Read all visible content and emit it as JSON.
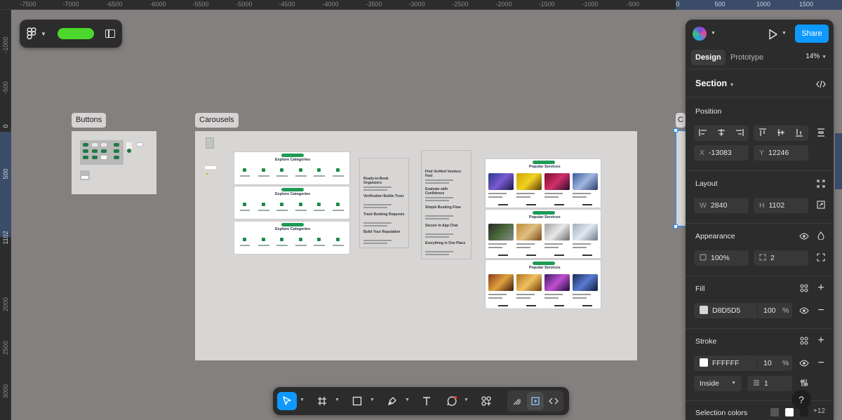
{
  "rulers": {
    "top_ticks": [
      "-7500",
      "-7000",
      "-6500",
      "-6000",
      "-5500",
      "-5000",
      "-4500",
      "-4000",
      "-3500",
      "-3000",
      "-2500",
      "-2000",
      "-1500",
      "-1000",
      "-500",
      "0",
      "500",
      "1000",
      "1500"
    ],
    "left_ticks": [
      "-1000",
      "-500",
      "0",
      "500",
      "1102",
      "2000",
      "2500",
      "3000"
    ]
  },
  "canvas": {
    "sections": {
      "buttons_label": "Buttons",
      "carousels_label": "Carousels",
      "partial_label": "C"
    },
    "explore_title": "Explore Categories",
    "popular_title": "Popular Services",
    "features_a": [
      "Ready-to-Book Organizers",
      "Verification Builds Trust",
      "Track Booking Requests",
      "Build Your Reputation"
    ],
    "features_b": [
      "Find Verified Vendors Fast",
      "Evaluate with Confidence",
      "Simple Booking Flow",
      "Secure In-App Chat",
      "Everything in One Place"
    ],
    "colors": {
      "canvas_bg": "#858080",
      "frame_bg": "#D8D5D5",
      "brand_green": "#1F9A55",
      "selection_blue": "#1E90FF"
    }
  },
  "toolbar_top": {
    "menu_icon": "figma-logo-icon",
    "panel_icon": "sidebar-toggle-icon"
  },
  "toolbar_bottom": {
    "tools": [
      "move-tool",
      "frame-tool",
      "shape-tool",
      "pen-tool",
      "text-tool",
      "comment-tool",
      "actions-tool"
    ],
    "modes": [
      "draw-mode",
      "design-mode",
      "dev-mode"
    ]
  },
  "panel": {
    "share_label": "Share",
    "tabs": [
      "Design",
      "Prototype"
    ],
    "zoom": "14%",
    "section_title": "Section",
    "position": {
      "title": "Position",
      "x_label": "X",
      "x_value": "-13083",
      "y_label": "Y",
      "y_value": "12246"
    },
    "layout": {
      "title": "Layout",
      "w_label": "W",
      "w_value": "2840",
      "h_label": "H",
      "h_value": "1102"
    },
    "appearance": {
      "title": "Appearance",
      "opacity": "100%",
      "radius": "2"
    },
    "fill": {
      "title": "Fill",
      "hex": "D8D5D5",
      "opacity": "100",
      "unit": "%"
    },
    "stroke": {
      "title": "Stroke",
      "hex": "FFFFFF",
      "opacity": "10",
      "unit": "%",
      "position": "Inside",
      "weight": "1"
    },
    "selection_colors": {
      "title": "Selection colors",
      "more": "+12"
    },
    "help": "?"
  }
}
